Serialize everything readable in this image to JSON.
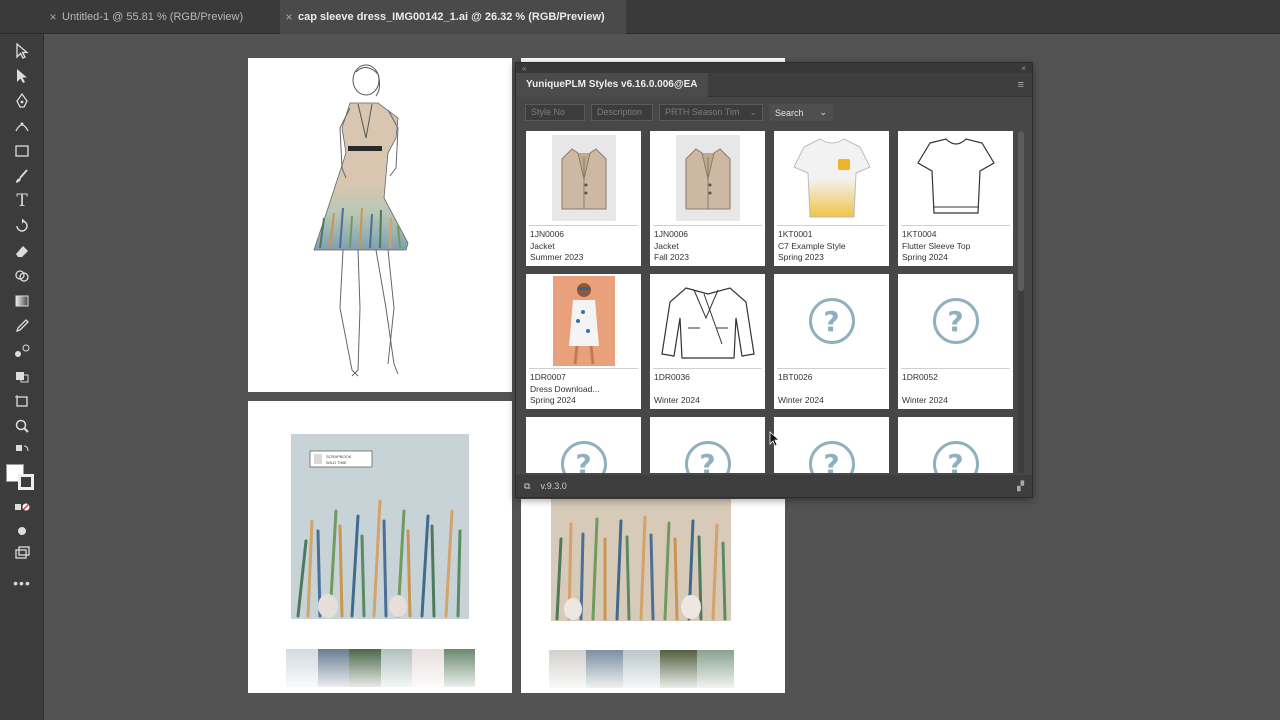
{
  "tabs": [
    {
      "label": "Untitled-1 @ 55.81 % (RGB/Preview)",
      "active": false
    },
    {
      "label": "cap sleeve dress_IMG00142_1.ai @ 26.32 % (RGB/Preview)",
      "active": true
    }
  ],
  "tools": [
    "selection-tool-icon",
    "direct-selection-tool-icon",
    "pen-tool-icon",
    "curvature-tool-icon",
    "rectangle-tool-icon",
    "paintbrush-tool-icon",
    "type-tool-icon",
    "rotate-tool-icon",
    "eraser-tool-icon",
    "shape-builder-tool-icon",
    "gradient-tool-icon",
    "eyedropper-tool-icon",
    "blend-tool-icon",
    "live-paint-icon",
    "artboard-tool-icon",
    "zoom-tool-icon"
  ],
  "artboards": {
    "print_palette": [
      "#cfd8dd",
      "#5d7289",
      "#3c5a3a",
      "#a9bbb8",
      "#e8dcdc",
      "#5f7f63"
    ],
    "print_palette_2": [
      "#cfcbc6",
      "#6d8296",
      "#b2c1c4",
      "#3e4d2a",
      "#7b9683"
    ],
    "tag_lines": [
      "SCRAPBOOK",
      "WILD TIME"
    ]
  },
  "panel": {
    "title": "YuniquePLM Styles v6.16.0.006@EA",
    "filters": {
      "style_no_placeholder": "Style No",
      "description_placeholder": "Description",
      "season_placeholder": "PRTH Season Tim",
      "search_label": "Search"
    },
    "cards": [
      {
        "code": "1JN0006",
        "name": "Jacket",
        "season": "Summer 2023",
        "thumb": "blazer"
      },
      {
        "code": "1JN0006",
        "name": "Jacket",
        "season": "Fall 2023",
        "thumb": "blazer"
      },
      {
        "code": "1KT0001",
        "name": "C7 Example Style",
        "season": "Spring 2023",
        "thumb": "tee-colored"
      },
      {
        "code": "1KT0004",
        "name": "Flutter Sleeve Top",
        "season": "Spring 2024",
        "thumb": "tee-sketch"
      },
      {
        "code": "1DR0007",
        "name": "Dress Download...",
        "season": "Spring 2024",
        "thumb": "photo"
      },
      {
        "code": "1DR0036",
        "name": "",
        "season": "Winter 2024",
        "thumb": "moto-jacket"
      },
      {
        "code": "1BT0026",
        "name": "",
        "season": "Winter 2024",
        "thumb": "unknown"
      },
      {
        "code": "1DR0052",
        "name": "",
        "season": "Winter 2024",
        "thumb": "unknown"
      },
      {
        "code": "",
        "name": "",
        "season": "",
        "thumb": "unknown"
      },
      {
        "code": "",
        "name": "",
        "season": "",
        "thumb": "unknown"
      },
      {
        "code": "",
        "name": "",
        "season": "",
        "thumb": "unknown"
      },
      {
        "code": "",
        "name": "",
        "season": "",
        "thumb": "unknown"
      }
    ],
    "footer_version": "v.9.3.0"
  }
}
